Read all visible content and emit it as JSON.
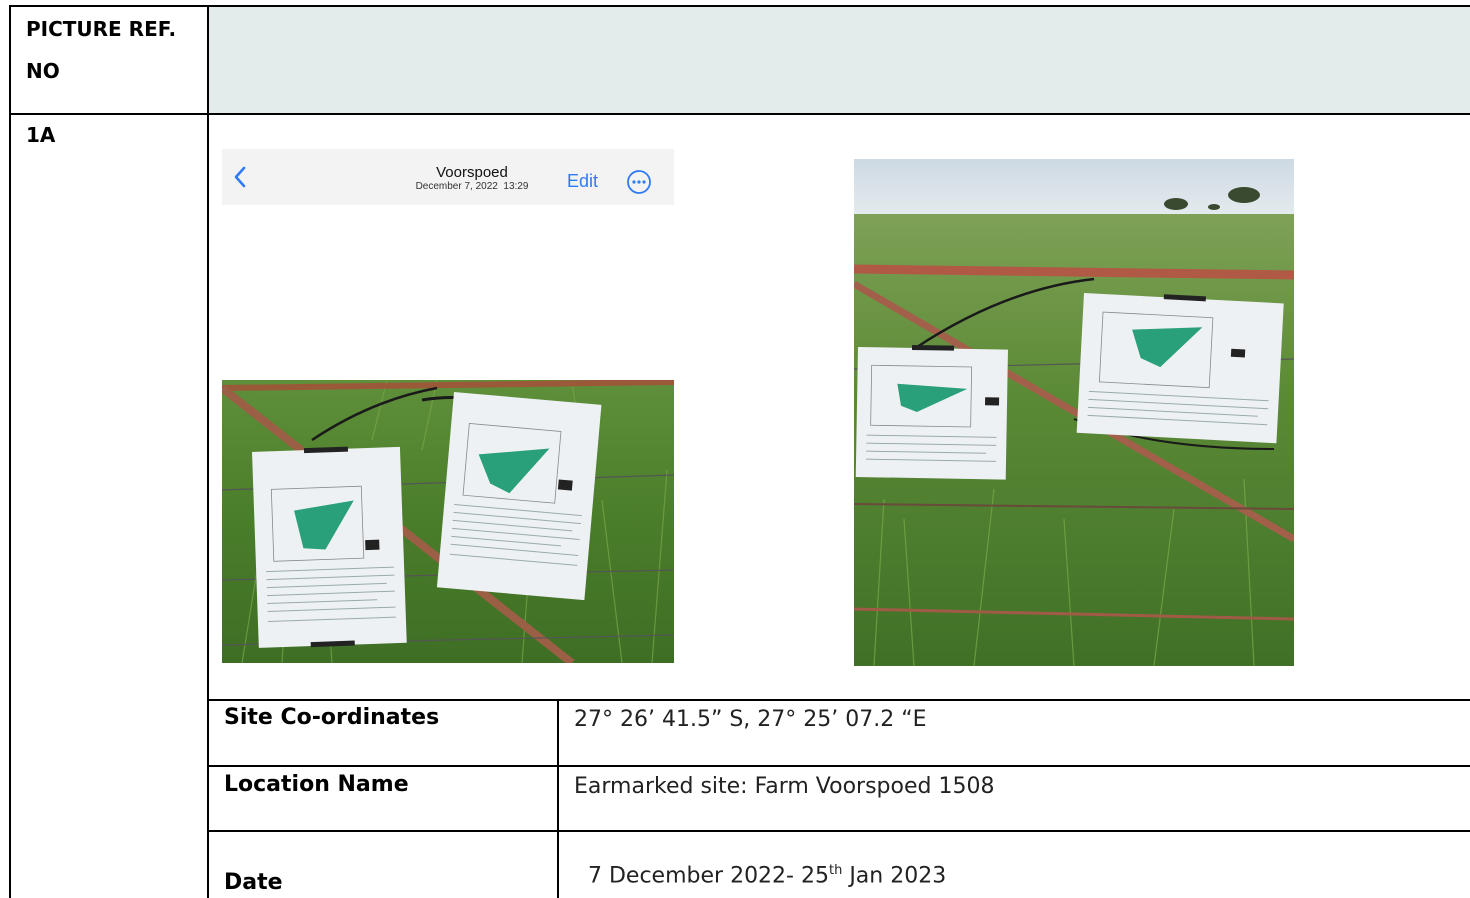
{
  "header": {
    "ref_label": "PICTURE REF. NO",
    "ref_line1": "PICTURE REF.",
    "ref_line2": "NO"
  },
  "row": {
    "ref": "1A",
    "phone_header": {
      "back_icon": "chevron-left-icon",
      "title": "Voorspoed",
      "subtitle": "December 7, 2022  13:29",
      "edit": "Edit",
      "more_icon": "ellipsis-circle-icon"
    },
    "details": [
      {
        "label": "Site Co-ordinates",
        "value": "27° 26’ 41.5” S, 27° 25’ 07.2 “E"
      },
      {
        "label": "Location Name",
        "value": "Earmarked site: Farm Voorspoed 1508"
      },
      {
        "label": "Date",
        "value_main": "7 December 2022- 25",
        "value_sup": "th",
        "value_tail": " Jan 2023"
      }
    ]
  },
  "colors": {
    "header_shade": "#e4ebeb",
    "ios_blue": "#2f7bf5",
    "grass": "#4f8a2e",
    "notice_green": "#2aa07a"
  }
}
